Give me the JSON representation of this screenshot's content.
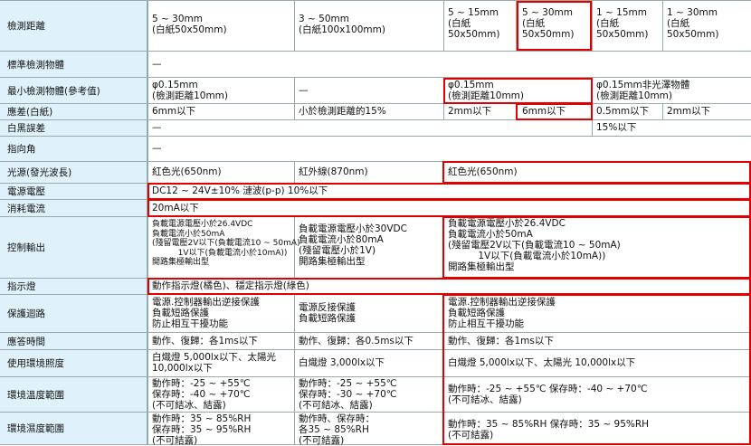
{
  "rows": {
    "detect_distance": {
      "label": "檢測距離",
      "c1": "5 ~ 30mm\n(白紙50x50mm)",
      "c2": "3 ~ 50mm\n(白紙100x100mm)",
      "c3": "5 ~ 15mm\n(白紙\n50x50mm)",
      "c4": "5 ~ 30mm\n(白紙\n50x50mm)",
      "c5": "1 ~ 15mm\n(白紙\n50x50mm)",
      "c6": "1 ~ 30mm\n(白紙\n50x50mm)"
    },
    "standard_object": {
      "label": "標準檢測物體",
      "c1": "—"
    },
    "min_object": {
      "label": "最小檢測物體(參考值)",
      "c1": "φ0.15mm\n(檢測距離10mm)",
      "c2": "—",
      "c3": "φ0.15mm\n(檢測距離10mm)",
      "c5": "φ0.15mm非光澤物體\n(檢測距離10mm)"
    },
    "hysteresis": {
      "label": "應差(白紙)",
      "c1": "6mm以下",
      "c2": "小於檢測距離的15%",
      "c3": "2mm以下",
      "c4": "6mm以下",
      "c5": "0.5mm以下",
      "c6": "2mm以下"
    },
    "bw_error": {
      "label": "白黑誤差",
      "c1": "—",
      "c5": "15%以下"
    },
    "directivity": {
      "label": "指向角",
      "c1": "—"
    },
    "light_source": {
      "label": "光源(發光波長)",
      "c1": "紅色光(650nm)",
      "c2": "紅外線(870nm)",
      "c3": "紅色光(650nm)"
    },
    "supply_voltage": {
      "label": "電源電壓",
      "c1": "DC12 ~ 24V±10% 漣波(p-p) 10%以下"
    },
    "current": {
      "label": "消耗電流",
      "c1": "20mA以下"
    },
    "control_output": {
      "label": "控制輸出",
      "c1": "負載電源電壓小於26.4VDC\n負載電流小於50mA\n(殘留電壓2V以下(負載電流10 ~ 50mA)\n          1V以下(負載電流小於10mA))\n開路集極輸出型",
      "c2": "負載電源電壓小於30VDC\n負載電流小於80mA\n(殘留電壓小於1V)\n開路集極輸出型",
      "c3": "負載電源電壓小於26.4VDC\n負載電流小於50mA\n(殘留電壓2V以下(負載電流10 ~ 50mA)\n          1V以下(負載電流小於10mA))\n開路集極輸出型"
    },
    "indicator": {
      "label": "指示燈",
      "c1": "動作指示燈(橘色)、穩定指示燈(綠色)"
    },
    "protection": {
      "label": "保護迴路",
      "c1": "電源.控制器輸出逆接保護\n負載短路保護\n防止相互干擾功能",
      "c2": "電源反接保護\n負載短路保護",
      "c3": "電源.控制器輸出逆接保護\n負載短路保護\n防止相互干擾功能"
    },
    "response": {
      "label": "應答時間",
      "c1": "動作、復歸：各1ms以下",
      "c2": "動作、復歸：各0.5ms以下",
      "c3": "動作、復歸：各1ms以下"
    },
    "illuminance": {
      "label": "使用環境照度",
      "c1": "白熾燈 5,000lx以下、太陽光\n10,000lx以下",
      "c2": "白熾燈 3,000lx以下",
      "c3": "白熾燈 5,000lx以下、太陽光 10,000lx以下"
    },
    "temperature": {
      "label": "環境溫度範圍",
      "c1": "動作時：-25 ~ +55℃\n保存時：-40 ~ +70℃\n(不可結冰、結露)",
      "c2": "動作時：-25 ~ +55℃\n保存時：-30 ~ +70℃\n(不可結冰、結露)",
      "c3": "動作時：-25 ~ +55℃ 保存時：-40 ~ +70℃\n(不可結冰、結露)"
    },
    "humidity": {
      "label": "環境濕度範圍",
      "c1": "動作時：35 ~ 85%RH\n保存時：35 ~ 95%RH\n(不可結露)",
      "c2": "動作時、保存時：\n各35 ~ 85%RH\n(不可結露)",
      "c3": "動作時：35 ~ 85%RH 保存時：35 ~ 95%RH\n(不可結露)"
    }
  },
  "colors": {
    "label_bg": "#dff2fb",
    "highlight": "#e00000",
    "grid": "#99aaaa"
  }
}
